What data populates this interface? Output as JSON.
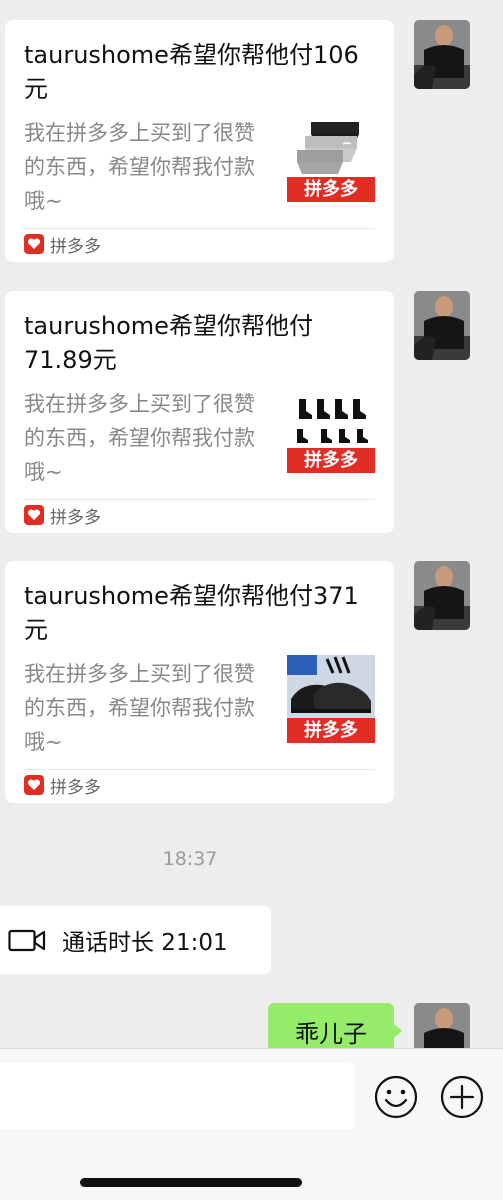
{
  "messages": [
    {
      "title": "taurushome希望你帮他付106元",
      "description": "我在拼多多上买到了很赞的东西，希望你帮我付款哦~",
      "thumb_badge": "拼多多",
      "product_icon": "underwear-product-image",
      "footer_label": "拼多多"
    },
    {
      "title": "taurushome希望你帮他付71.89元",
      "description": "我在拼多多上买到了很赞的东西，希望你帮我付款哦~",
      "thumb_badge": "拼多多",
      "product_icon": "socks-product-image",
      "footer_label": "拼多多"
    },
    {
      "title": "taurushome希望你帮他付371元",
      "description": "我在拼多多上买到了很赞的东西，希望你帮我付款哦~",
      "thumb_badge": "拼多多",
      "product_icon": "sneakers-product-image",
      "footer_label": "拼多多"
    }
  ],
  "timestamp": "18:37",
  "call_message": {
    "icon": "video-call-icon",
    "text": "通话时长 21:01"
  },
  "sent_message": {
    "text": "乖儿子"
  },
  "input_bar": {
    "emoji_icon": "emoji-icon",
    "plus_icon": "plus-icon"
  },
  "colors": {
    "background": "#ededed",
    "sent_bubble": "#95ec69",
    "pdd_red": "#e02e24"
  }
}
